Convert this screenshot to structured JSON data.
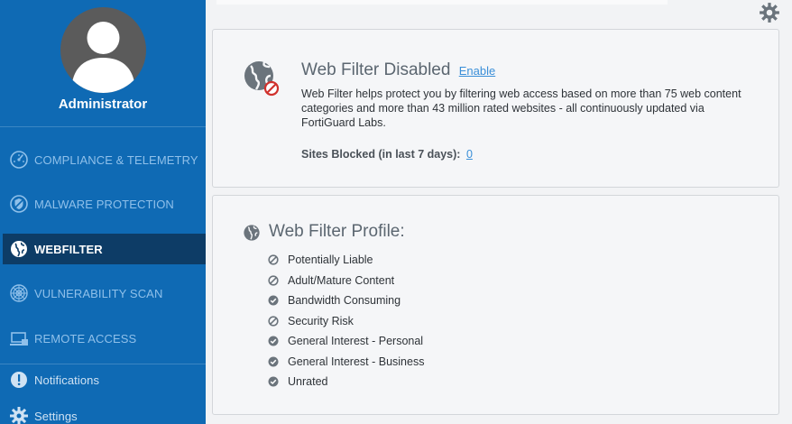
{
  "sidebar": {
    "user_name": "Administrator",
    "items": [
      {
        "label": "COMPLIANCE & TELEMETRY",
        "icon": "gauge-icon",
        "active": false
      },
      {
        "label": "MALWARE PROTECTION",
        "icon": "shield-icon",
        "active": false
      },
      {
        "label": "WEBFILTER",
        "icon": "globe-icon",
        "active": true
      },
      {
        "label": "VULNERABILITY SCAN",
        "icon": "radar-icon",
        "active": false
      },
      {
        "label": "REMOTE ACCESS",
        "icon": "laptop-icon",
        "active": false
      }
    ],
    "lower_items": [
      {
        "label": "Notifications",
        "icon": "info-icon"
      },
      {
        "label": "Settings",
        "icon": "gear-icon"
      }
    ]
  },
  "webfilter": {
    "title": "Web Filter Disabled",
    "enable_label": "Enable",
    "description": "Web Filter helps protect you by filtering web access based on more than 75 web content categories and more than 43 million rated websites - all continuously updated via FortiGuard Labs.",
    "sites_blocked_label": "Sites Blocked (in last 7 days):",
    "sites_blocked_count": "0"
  },
  "profile": {
    "title": "Web Filter Profile:",
    "categories": [
      {
        "label": "Potentially Liable",
        "status": "blocked"
      },
      {
        "label": "Adult/Mature Content",
        "status": "blocked"
      },
      {
        "label": "Bandwidth Consuming",
        "status": "allowed"
      },
      {
        "label": "Security Risk",
        "status": "blocked"
      },
      {
        "label": "General Interest - Personal",
        "status": "allowed"
      },
      {
        "label": "General Interest - Business",
        "status": "allowed"
      },
      {
        "label": "Unrated",
        "status": "allowed"
      }
    ]
  },
  "colors": {
    "sidebar_bg": "#0f6ab4",
    "active_bg": "#0d3c66",
    "link": "#3a8fd8",
    "status_icon": "#6b747c",
    "blocked_badge": "#d0312d"
  }
}
